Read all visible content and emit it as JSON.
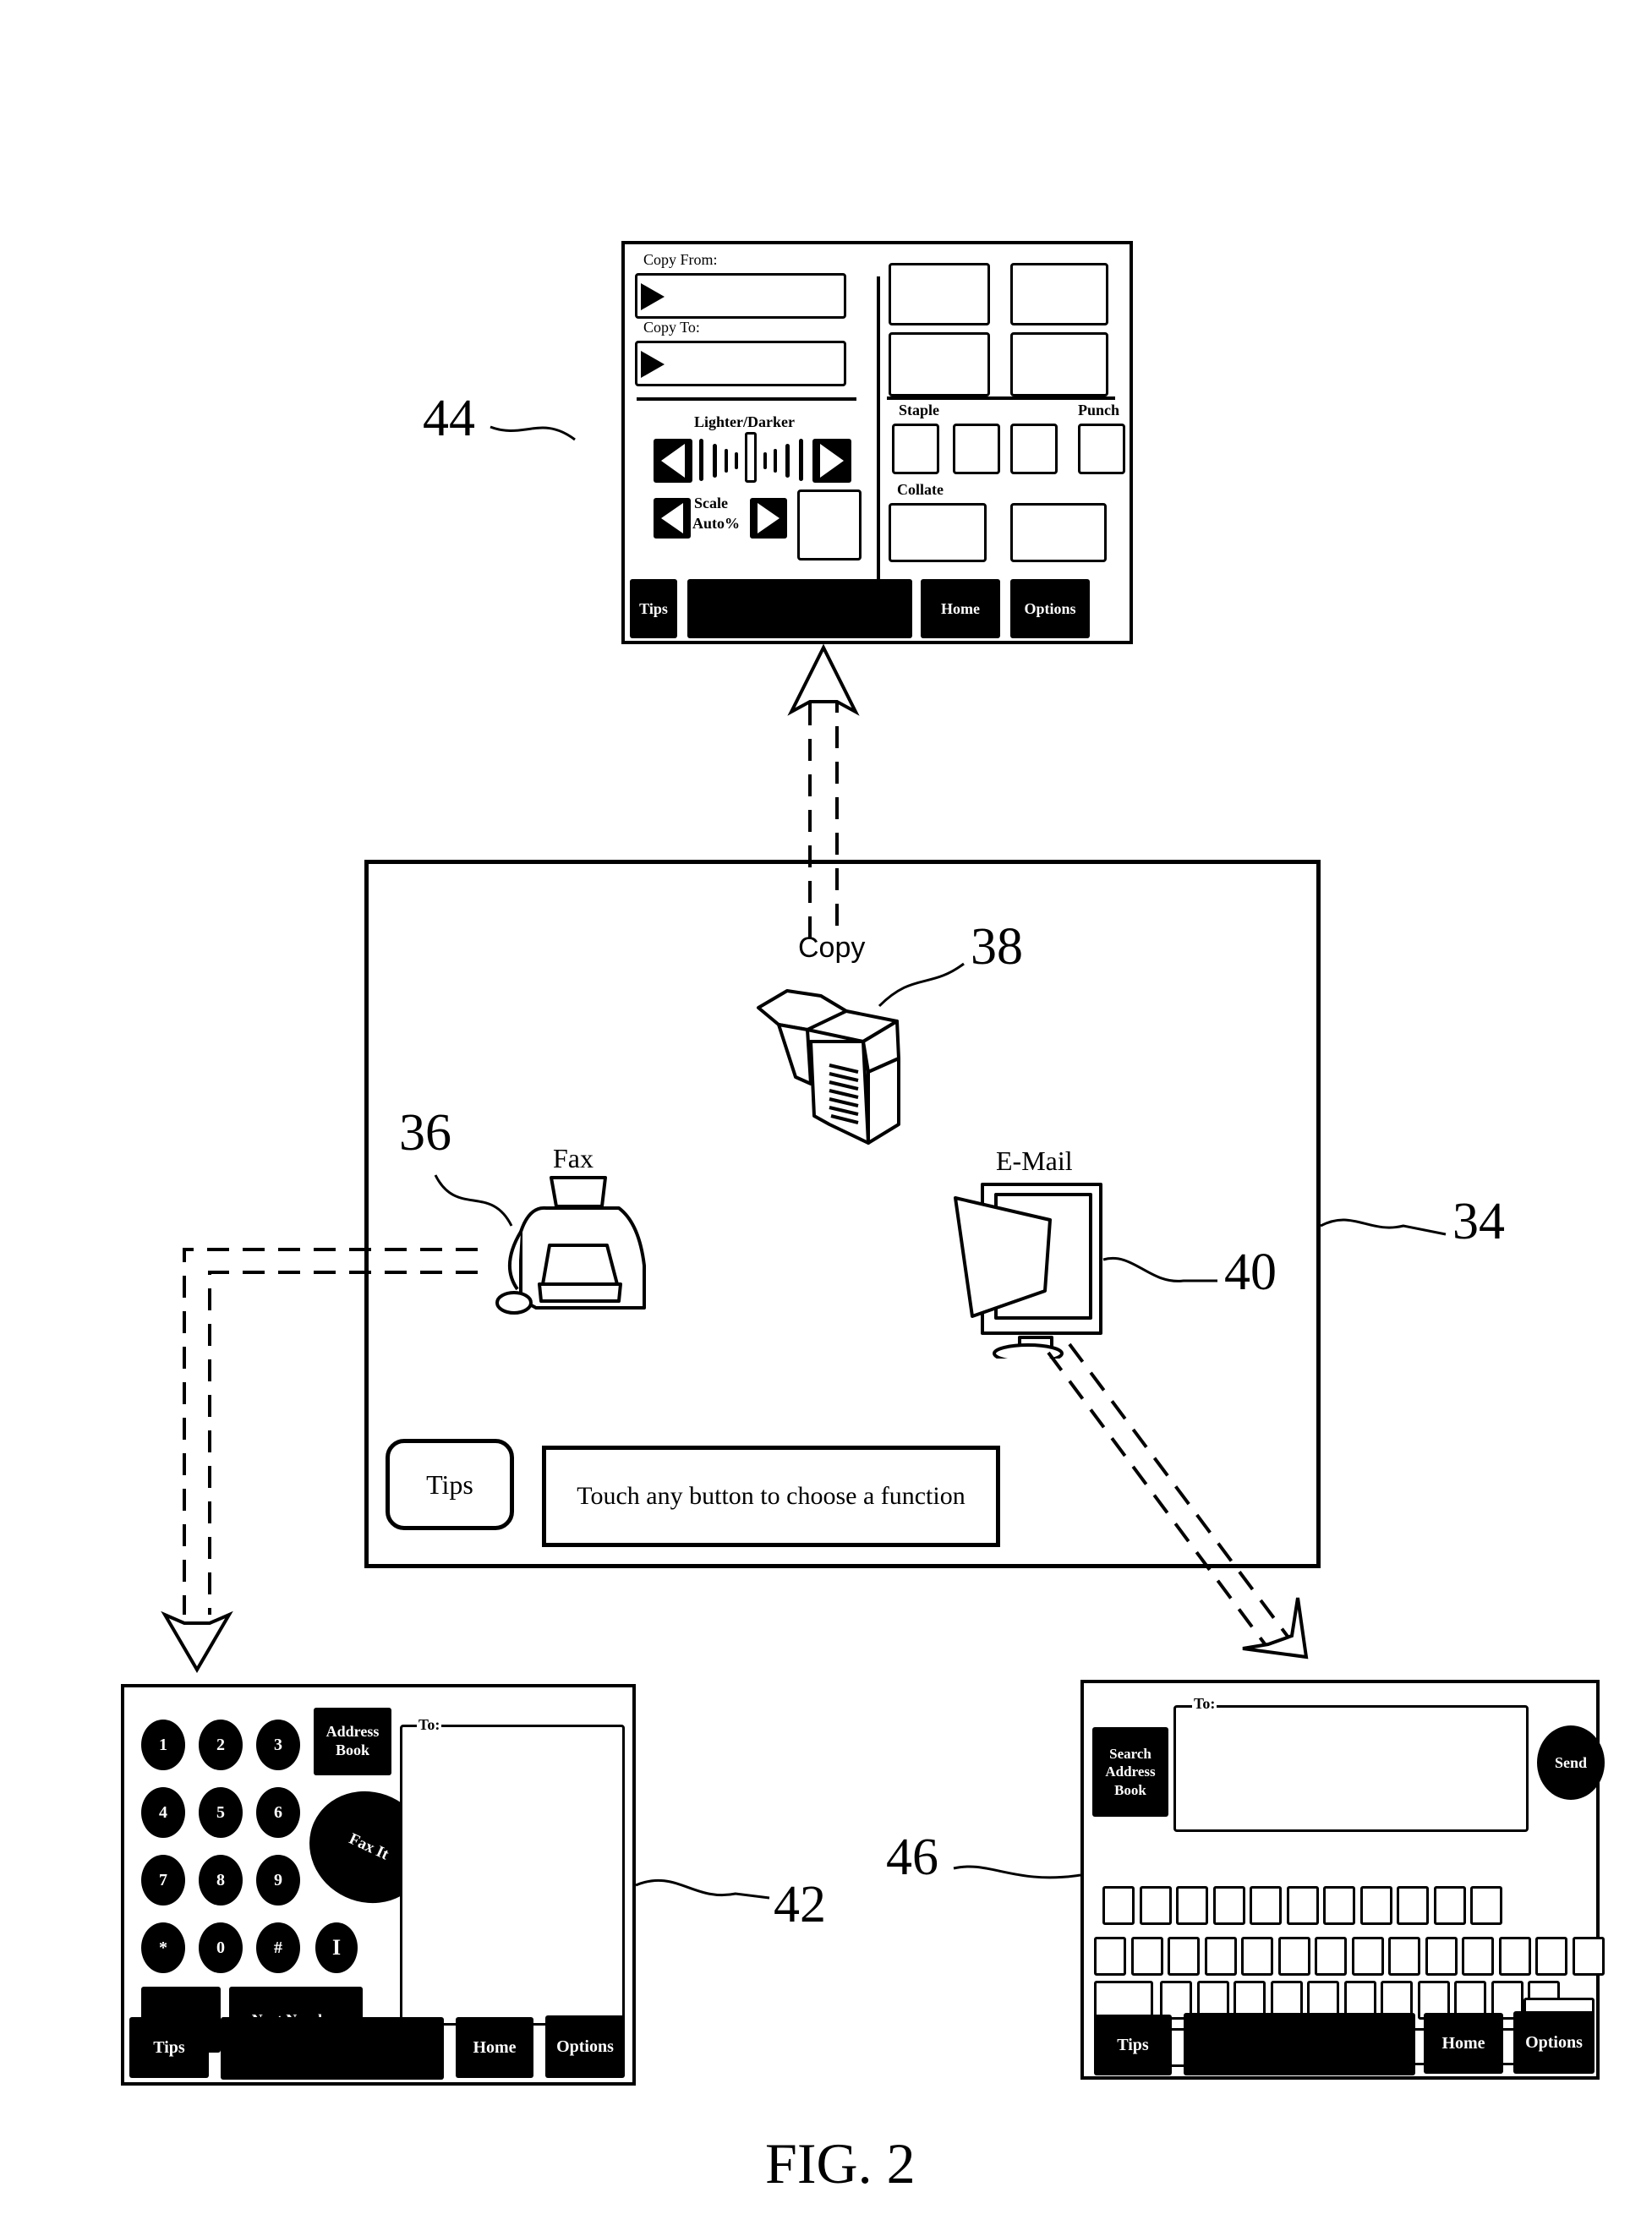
{
  "figure_label": "FIG. 2",
  "reference_numerals": {
    "main_screen": "34",
    "fax_icon": "36",
    "copy_icon": "38",
    "email_icon": "40",
    "fax_screen": "42",
    "copy_screen": "44",
    "email_screen": "46"
  },
  "main_screen": {
    "icons": [
      {
        "label": "Copy",
        "icon": "copier-icon"
      },
      {
        "label": "Fax",
        "icon": "fax-machine-icon"
      },
      {
        "label": "E-Mail",
        "icon": "computer-monitor-icon"
      }
    ],
    "tips_button": "Tips",
    "message": "Touch any button to choose a function"
  },
  "copy_screen": {
    "copy_from_label": "Copy From:",
    "copy_to_label": "Copy To:",
    "lighter_darker_label": "Lighter/Darker",
    "scale_label": "Scale",
    "scale_value": "Auto%",
    "staple_label": "Staple",
    "punch_label": "Punch",
    "collate_label": "Collate",
    "bottom_buttons": [
      "Tips",
      "",
      "Home",
      "Options"
    ]
  },
  "fax_screen": {
    "keypad": [
      "1",
      "2",
      "3",
      "4",
      "5",
      "6",
      "7",
      "8",
      "9",
      "*",
      "0",
      "#"
    ],
    "address_book_button": "Address Book",
    "fax_button": "Fax It",
    "pause_key": "I",
    "backspace_icon": "left-arrow-icon",
    "next_number_button": "Next Number",
    "to_label": "To:",
    "bottom_buttons": [
      "Tips",
      "",
      "Home",
      "Options"
    ]
  },
  "email_screen": {
    "search_address_book_button": "Search Address Book",
    "to_label": "To:",
    "send_button": "Send",
    "bottom_buttons": [
      "Tips",
      "",
      "Home",
      "Options"
    ]
  }
}
